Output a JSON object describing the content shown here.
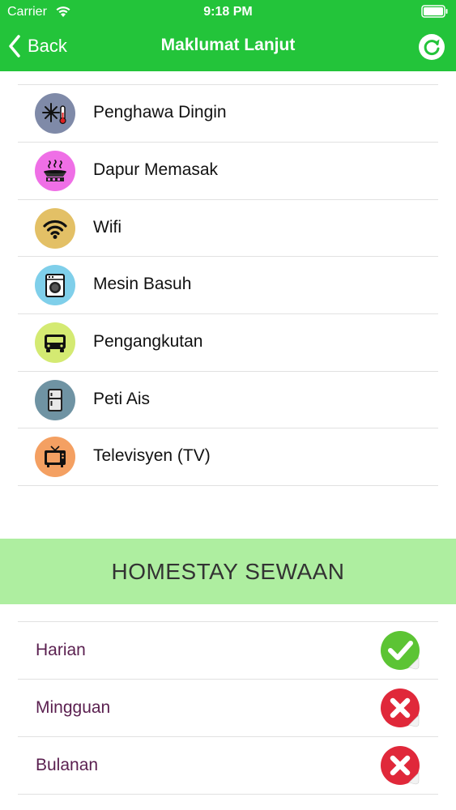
{
  "status_bar": {
    "carrier": "Carrier",
    "time": "9:18 PM"
  },
  "nav": {
    "back_label": "Back",
    "title": "Maklumat Lanjut"
  },
  "facilities": [
    {
      "label": "Penghawa Dingin",
      "icon": "air-conditioner-icon",
      "color": "#7f8aa8"
    },
    {
      "label": "Dapur Memasak",
      "icon": "cooking-stove-icon",
      "color": "#ef6fe6"
    },
    {
      "label": "Wifi",
      "icon": "wifi-icon",
      "color": "#e3c066"
    },
    {
      "label": "Mesin Basuh",
      "icon": "washing-machine-icon",
      "color": "#7fcfea"
    },
    {
      "label": "Pengangkutan",
      "icon": "bus-icon",
      "color": "#d4ea72"
    },
    {
      "label": "Peti Ais",
      "icon": "refrigerator-icon",
      "color": "#6f93a3"
    },
    {
      "label": "Televisyen (TV)",
      "icon": "television-icon",
      "color": "#f4a062"
    }
  ],
  "rental_section": {
    "title": "HOMESTAY SEWAAN",
    "items": [
      {
        "label": "Harian",
        "status": "available",
        "icon": "green-check-icon"
      },
      {
        "label": "Mingguan",
        "status": "unavailable",
        "icon": "red-cross-icon"
      },
      {
        "label": "Bulanan",
        "status": "unavailable",
        "icon": "red-cross-icon"
      }
    ]
  },
  "colors": {
    "header": "#23c43a",
    "section_header": "#aeeea0",
    "rental_text": "#5a1f4f",
    "check": "#5cc434",
    "cross": "#e0283a"
  }
}
